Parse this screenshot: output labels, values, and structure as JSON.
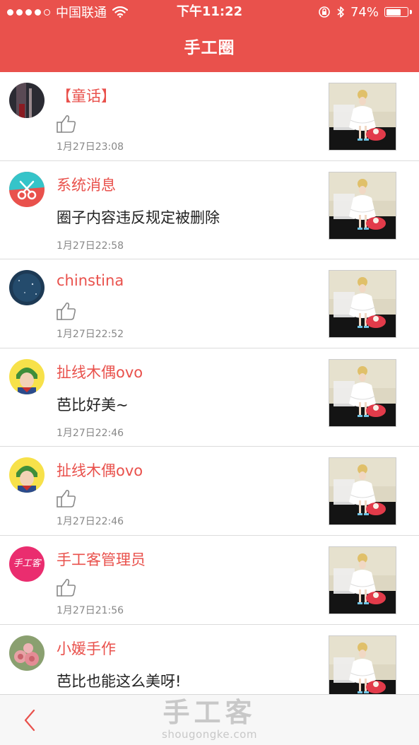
{
  "status_bar": {
    "carrier": "中国联通",
    "time": "下午11:22",
    "battery_percent_label": "74%",
    "battery_level": 0.74,
    "signal_bars_filled": 4,
    "signal_bars_total": 5
  },
  "header": {
    "title": "手工圈"
  },
  "feed": {
    "items": [
      {
        "username": "【童话】",
        "type": "like",
        "text": "",
        "timestamp": "1月27日23:08",
        "avatar": "dark-photo"
      },
      {
        "username": "系统消息",
        "type": "text",
        "text": "圈子内容违反规定被删除",
        "timestamp": "1月27日22:58",
        "avatar": "scissors-logo"
      },
      {
        "username": "chinstina",
        "type": "like",
        "text": "",
        "timestamp": "1月27日22:52",
        "avatar": "night-sky"
      },
      {
        "username": "扯线木偶ovo",
        "type": "text",
        "text": "芭比好美~",
        "timestamp": "1月27日22:46",
        "avatar": "cartoon-person"
      },
      {
        "username": "扯线木偶ovo",
        "type": "like",
        "text": "",
        "timestamp": "1月27日22:46",
        "avatar": "cartoon-person"
      },
      {
        "username": "手工客管理员",
        "type": "like",
        "text": "",
        "timestamp": "1月27日21:56",
        "avatar": "pink-logo",
        "avatar_text": "手工客"
      },
      {
        "username": "小媛手作",
        "type": "text",
        "text": "芭比也能这么美呀!",
        "timestamp": "",
        "avatar": "roses"
      }
    ]
  },
  "bottom_bar": {
    "back_icon": "chevron-left-icon",
    "watermark_cn": "手工客",
    "watermark_en": "shougongke.com"
  },
  "colors": {
    "accent": "#e9514c",
    "text": "#222222",
    "muted": "#888888",
    "divider": "#dcdcdc"
  }
}
